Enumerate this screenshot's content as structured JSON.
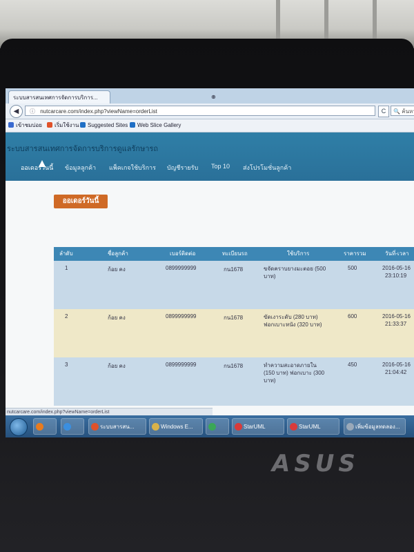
{
  "browser": {
    "tabs": [
      {
        "label": "ระบบสารสนเทศการจัดการบริการ...",
        "active": true
      },
      {
        "label": "",
        "active": false
      }
    ],
    "url": "nutcarcare.com/index.php?viewName=orderList",
    "search_placeholder": "ค้นหา",
    "favorites": [
      {
        "label": "เข้าชมบ่อย",
        "icon": "bookmark-icon"
      },
      {
        "label": "เริ่มใช้งาน",
        "icon": "firefox-icon"
      },
      {
        "label": "Suggested Sites",
        "icon": "ie-icon"
      },
      {
        "label": "Web Slice Gallery",
        "icon": "ie-icon"
      }
    ],
    "status_text": "nutcarcare.com/index.php?viewName=orderList"
  },
  "site": {
    "title": "ระบบสารสนเทศการจัดการบริการดูแลรักษารถ",
    "nav": [
      {
        "label": "ออเดอร์วันนี้",
        "active": true
      },
      {
        "label": "ข้อมูลลูกค้า",
        "active": false
      },
      {
        "label": "แพ็คเกจใช้บริการ",
        "active": false
      },
      {
        "label": "บัญชีรายรับ",
        "active": false
      },
      {
        "label": "Top 10",
        "active": false
      },
      {
        "label": "ส่งโปรโมชั่นลูกค้า",
        "active": false
      }
    ],
    "page_heading": "ออเดอร์วันนี้"
  },
  "table": {
    "headers": [
      "ลำดับ",
      "ชื่อลูกค้า",
      "เบอร์ติดต่อ",
      "ทะเบียนรถ",
      "ใช้บริการ",
      "ราคารวม",
      "วันที่-เวลา"
    ],
    "rows": [
      {
        "no": "1",
        "name": "ก้อย คง",
        "phone": "0899999999",
        "plate": "กน1678",
        "service": "ขจัดคราบยางมะตอย (500 บาท)",
        "price": "500",
        "date": "2016-05-16",
        "time": "23:10:19"
      },
      {
        "no": "2",
        "name": "ก้อย คง",
        "phone": "0899999999",
        "plate": "กน1678",
        "service": "ขัดเงาระดับ (280 บาท) ฟอกเบาะหนัง (320 บาท)",
        "price": "600",
        "date": "2016-05-16",
        "time": "21:33:37"
      },
      {
        "no": "3",
        "name": "ก้อย คง",
        "phone": "0899999999",
        "plate": "กน1678",
        "service": "ทำความสะอาดภายใน (150 บาท) ฟอกเบาะ (300 บาท)",
        "price": "450",
        "date": "2016-05-16",
        "time": "21:04:42"
      }
    ]
  },
  "taskbar": {
    "items": [
      {
        "label": "",
        "icon": "media-player-icon"
      },
      {
        "label": "",
        "icon": "ie-icon"
      },
      {
        "label": "ระบบสารสน...",
        "icon": "firefox-icon"
      },
      {
        "label": "Windows E...",
        "icon": "folder-icon"
      },
      {
        "label": "",
        "icon": "chrome-icon"
      },
      {
        "label": "StarUML",
        "icon": "staruml-icon"
      },
      {
        "label": "StarUML",
        "icon": "staruml-icon"
      },
      {
        "label": "เพิ่มข้อมูลทดลอง...",
        "icon": "app-icon"
      }
    ]
  },
  "device": {
    "brand": "ASUS"
  }
}
